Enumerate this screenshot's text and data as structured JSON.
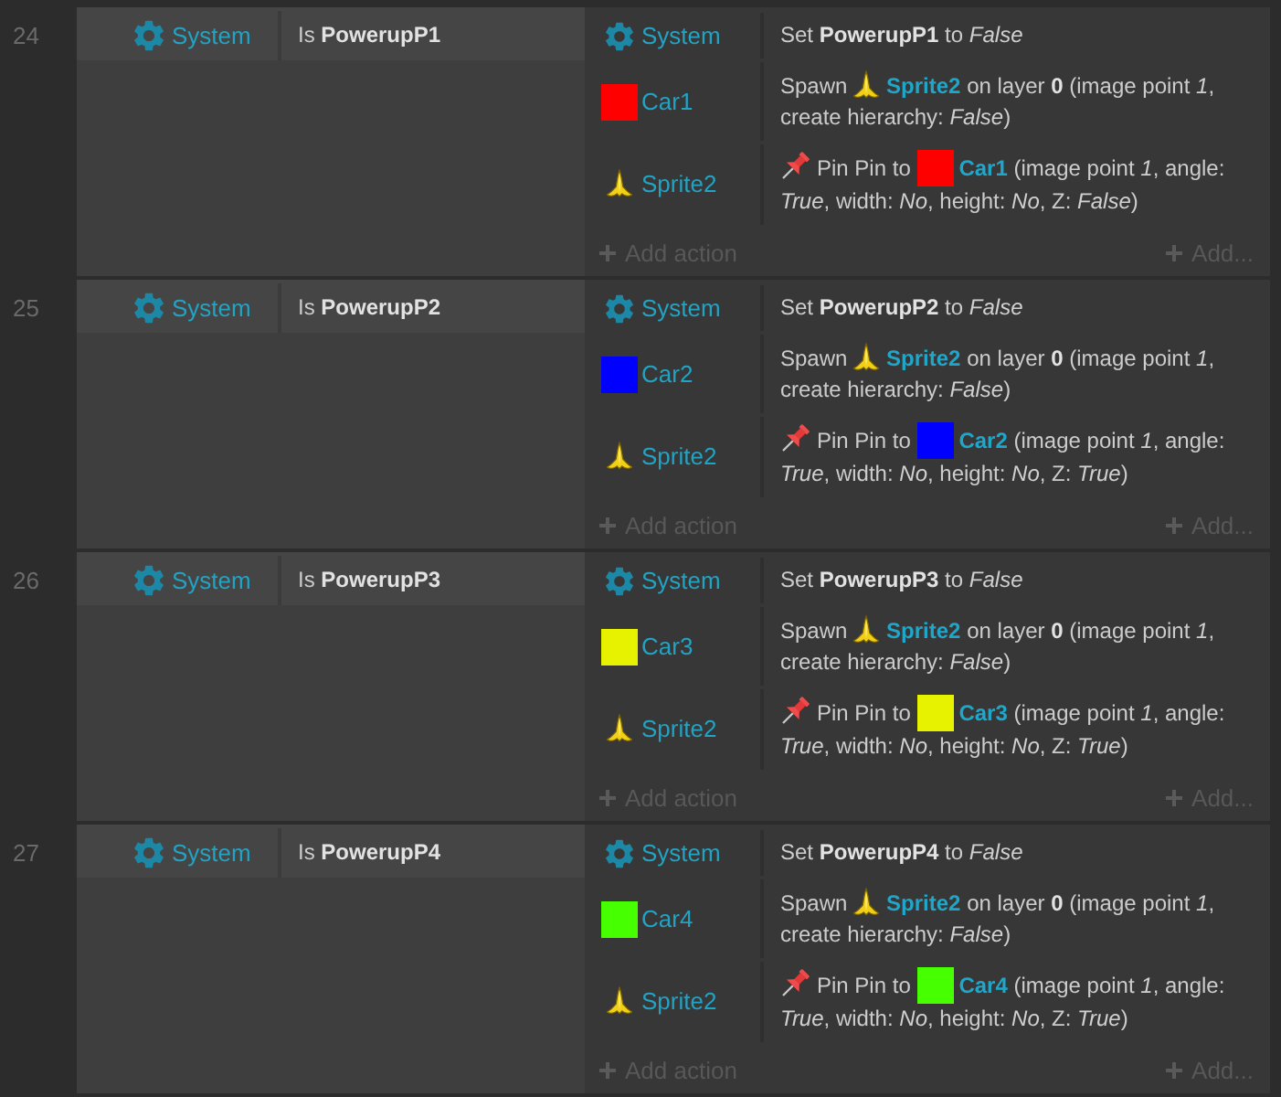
{
  "events": [
    {
      "number": "24",
      "conditions": [
        {
          "object": "System",
          "kind": "system",
          "text": "Is **PowerupP1**"
        }
      ],
      "actions": [
        {
          "object": "System",
          "kind": "system",
          "lines": [
            [
              {
                "kind": "text",
                "text": "Set **PowerupP1** to *False*"
              }
            ]
          ]
        },
        {
          "object": "Car1",
          "kind": "car",
          "color": "#ff0000",
          "lines": [
            [
              {
                "kind": "text",
                "text": "Spawn"
              },
              {
                "kind": "sprite",
                "text": "Sprite2"
              },
              {
                "kind": "text",
                "text": "on layer **0** (image point *1*,"
              }
            ],
            [
              {
                "kind": "text",
                "text": "create hierarchy: *False*)"
              }
            ]
          ]
        },
        {
          "object": "Sprite2",
          "kind": "sprite",
          "lines": [
            [
              {
                "kind": "behavior"
              },
              {
                "kind": "text",
                "text": "Pin Pin to"
              },
              {
                "kind": "car",
                "color": "#ff0000",
                "text": "Car1"
              },
              {
                "kind": "text",
                "text": "(image point *1*, angle:"
              }
            ],
            [
              {
                "kind": "text",
                "text": "*True*, width: *No*, height: *No*, Z: *False*)"
              }
            ]
          ]
        }
      ],
      "add_action": "Add action",
      "add_more": "Add..."
    },
    {
      "number": "25",
      "conditions": [
        {
          "object": "System",
          "kind": "system",
          "text": "Is **PowerupP2**"
        }
      ],
      "actions": [
        {
          "object": "System",
          "kind": "system",
          "lines": [
            [
              {
                "kind": "text",
                "text": "Set **PowerupP2** to *False*"
              }
            ]
          ]
        },
        {
          "object": "Car2",
          "kind": "car",
          "color": "#0000ff",
          "lines": [
            [
              {
                "kind": "text",
                "text": "Spawn"
              },
              {
                "kind": "sprite",
                "text": "Sprite2"
              },
              {
                "kind": "text",
                "text": "on layer **0** (image point *1*,"
              }
            ],
            [
              {
                "kind": "text",
                "text": "create hierarchy: *False*)"
              }
            ]
          ]
        },
        {
          "object": "Sprite2",
          "kind": "sprite",
          "lines": [
            [
              {
                "kind": "behavior"
              },
              {
                "kind": "text",
                "text": "Pin Pin to"
              },
              {
                "kind": "car",
                "color": "#0000ff",
                "text": "Car2"
              },
              {
                "kind": "text",
                "text": "(image point *1*, angle:"
              }
            ],
            [
              {
                "kind": "text",
                "text": "*True*, width: *No*, height: *No*, Z: *True*)"
              }
            ]
          ]
        }
      ],
      "add_action": "Add action",
      "add_more": "Add..."
    },
    {
      "number": "26",
      "conditions": [
        {
          "object": "System",
          "kind": "system",
          "text": "Is **PowerupP3**"
        }
      ],
      "actions": [
        {
          "object": "System",
          "kind": "system",
          "lines": [
            [
              {
                "kind": "text",
                "text": "Set **PowerupP3** to *False*"
              }
            ]
          ]
        },
        {
          "object": "Car3",
          "kind": "car",
          "color": "#e6f200",
          "lines": [
            [
              {
                "kind": "text",
                "text": "Spawn"
              },
              {
                "kind": "sprite",
                "text": "Sprite2"
              },
              {
                "kind": "text",
                "text": "on layer **0** (image point *1*,"
              }
            ],
            [
              {
                "kind": "text",
                "text": "create hierarchy: *False*)"
              }
            ]
          ]
        },
        {
          "object": "Sprite2",
          "kind": "sprite",
          "lines": [
            [
              {
                "kind": "behavior"
              },
              {
                "kind": "text",
                "text": "Pin Pin to"
              },
              {
                "kind": "car",
                "color": "#e6f200",
                "text": "Car3"
              },
              {
                "kind": "text",
                "text": "(image point *1*, angle:"
              }
            ],
            [
              {
                "kind": "text",
                "text": "*True*, width: *No*, height: *No*, Z: *True*)"
              }
            ]
          ]
        }
      ],
      "add_action": "Add action",
      "add_more": "Add..."
    },
    {
      "number": "27",
      "conditions": [
        {
          "object": "System",
          "kind": "system",
          "text": "Is **PowerupP4**"
        }
      ],
      "actions": [
        {
          "object": "System",
          "kind": "system",
          "lines": [
            [
              {
                "kind": "text",
                "text": "Set **PowerupP4** to *False*"
              }
            ]
          ]
        },
        {
          "object": "Car4",
          "kind": "car",
          "color": "#46ff00",
          "lines": [
            [
              {
                "kind": "text",
                "text": "Spawn"
              },
              {
                "kind": "sprite",
                "text": "Sprite2"
              },
              {
                "kind": "text",
                "text": "on layer **0** (image point *1*,"
              }
            ],
            [
              {
                "kind": "text",
                "text": "create hierarchy: *False*)"
              }
            ]
          ]
        },
        {
          "object": "Sprite2",
          "kind": "sprite",
          "lines": [
            [
              {
                "kind": "behavior"
              },
              {
                "kind": "text",
                "text": "Pin Pin to"
              },
              {
                "kind": "car",
                "color": "#46ff00",
                "text": "Car4"
              },
              {
                "kind": "text",
                "text": "(image point *1*, angle:"
              }
            ],
            [
              {
                "kind": "text",
                "text": "*True*, width: *No*, height: *No*, Z: *True*)"
              }
            ]
          ]
        }
      ],
      "add_action": "Add action",
      "add_more": "Add..."
    }
  ]
}
